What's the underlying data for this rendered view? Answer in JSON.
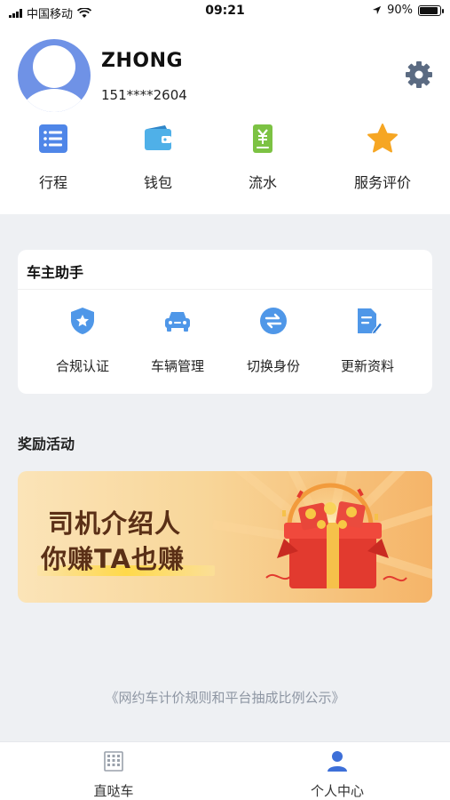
{
  "status_bar": {
    "carrier": "中国移动",
    "time": "09:21",
    "battery": "90%",
    "battery_level": 0.9
  },
  "profile": {
    "name": "ZHONG",
    "phone": "151****2604"
  },
  "quick_menu": [
    {
      "label": "行程",
      "icon": "list-icon"
    },
    {
      "label": "钱包",
      "icon": "wallet-icon"
    },
    {
      "label": "流水",
      "icon": "yen-document-icon"
    },
    {
      "label": "服务评价",
      "icon": "star-icon"
    }
  ],
  "assistant": {
    "title": "车主助手",
    "items": [
      {
        "label": "合规认证",
        "icon": "shield-star-icon"
      },
      {
        "label": "车辆管理",
        "icon": "car-icon"
      },
      {
        "label": "切换身份",
        "icon": "swap-icon"
      },
      {
        "label": "更新资料",
        "icon": "edit-document-icon"
      }
    ]
  },
  "rewards": {
    "title": "奖励活动",
    "banner_line1": "司机介绍人",
    "banner_line2": "你赚TA也赚"
  },
  "footer_link": "《网约车计价规则和平台抽成比例公示》",
  "tabbar": {
    "tabs": [
      {
        "label": "直哒车",
        "icon": "building-icon",
        "active": false
      },
      {
        "label": "个人中心",
        "icon": "user-icon",
        "active": true
      }
    ]
  },
  "colors": {
    "accent_blue": "#5b8def",
    "star_orange": "#f6a623",
    "banner_text": "#5a2f16"
  }
}
